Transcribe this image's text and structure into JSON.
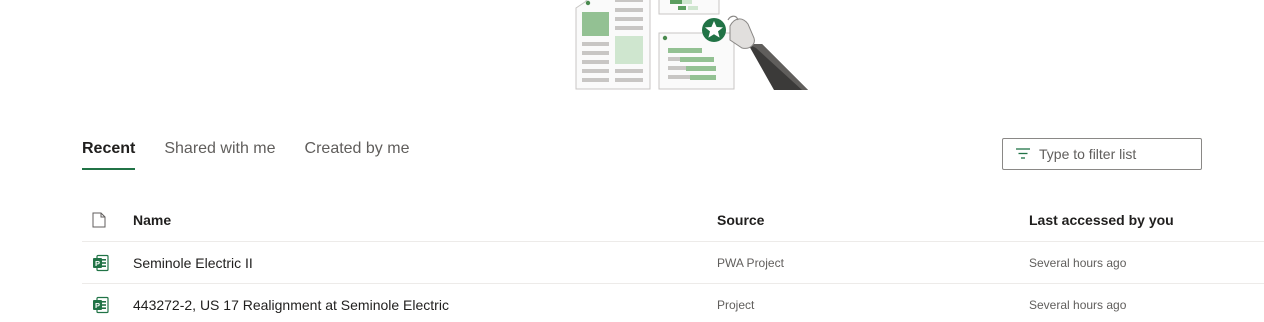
{
  "tabs": [
    {
      "label": "Recent",
      "active": true
    },
    {
      "label": "Shared with me",
      "active": false
    },
    {
      "label": "Created by me",
      "active": false
    }
  ],
  "filter": {
    "placeholder": "Type to filter list",
    "icon": "filter-icon"
  },
  "table": {
    "columns": {
      "icon": "document-icon",
      "name": "Name",
      "source": "Source",
      "last_accessed": "Last accessed by you"
    },
    "rows": [
      {
        "icon": "project-file-icon",
        "name": "Seminole Electric II",
        "source": "PWA Project",
        "last_accessed": "Several hours ago"
      },
      {
        "icon": "project-file-icon",
        "name": "443272-2, US 17 Realignment at Seminole Electric",
        "source": "Project",
        "last_accessed": "Several hours ago"
      }
    ]
  },
  "colors": {
    "accent": "#217346",
    "text": "#201f1e",
    "muted": "#605e5c",
    "divider": "#edebe9"
  }
}
